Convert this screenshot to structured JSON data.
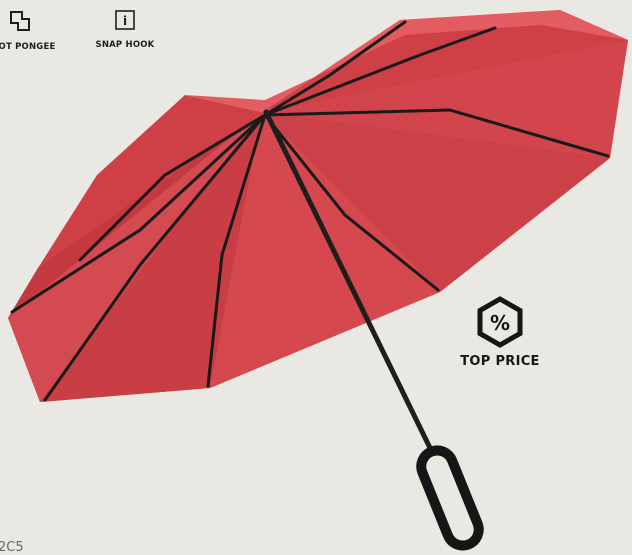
{
  "features": [
    {
      "label": "OT PONGEE",
      "icon": "fabric-pongee-icon"
    },
    {
      "label": "SNAP HOOK",
      "icon": "info-icon"
    }
  ],
  "info_icon_glyph": "i",
  "badge": {
    "label": "TOP PRICE",
    "glyph": "%",
    "icon": "percent-hexagon-icon"
  },
  "page_fragment": "2C5",
  "colors": {
    "background": "#e9e8e2",
    "canopy": "#cf3f46",
    "frame": "#1a1a1a"
  }
}
